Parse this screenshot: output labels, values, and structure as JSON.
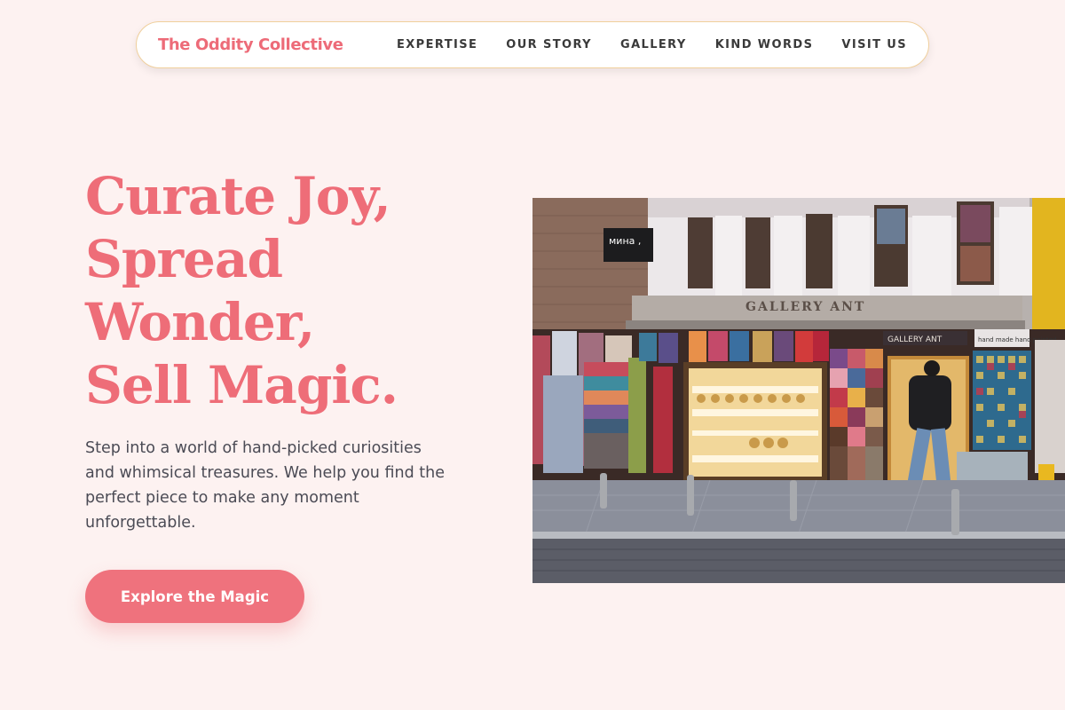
{
  "nav": {
    "brand": "The Oddity Collective",
    "links": [
      "EXPERTISE",
      "OUR STORY",
      "GALLERY",
      "KIND WORDS",
      "VISIT US"
    ]
  },
  "hero": {
    "title_lines": [
      "Curate Joy,",
      "Spread",
      "Wonder,",
      "Sell Magic."
    ],
    "subtitle": "Step into a world of hand-picked curiosities and whimsical treasures. We help you find the perfect piece to make any moment unforgettable.",
    "cta_label": "Explore the Magic"
  },
  "photo": {
    "sign_main": "GALLERY ANT",
    "sign_small": "GALLERY ANT",
    "sign_black": "мина ,",
    "sign_right": "hand made hand painted"
  },
  "colors": {
    "accent": "#ee6d78",
    "background": "#fdf2f1",
    "nav_border": "#f0cf9c"
  }
}
